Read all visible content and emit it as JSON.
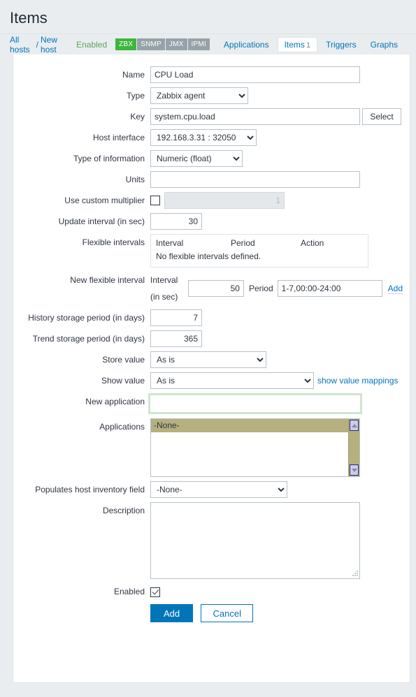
{
  "header": {
    "title": "Items"
  },
  "breadcrumb": {
    "all_hosts": "All hosts",
    "separator": "/",
    "host_name": "New host",
    "status": "Enabled",
    "interfaces": [
      {
        "label": "ZBX",
        "active": true
      },
      {
        "label": "SNMP",
        "active": false
      },
      {
        "label": "JMX",
        "active": false
      },
      {
        "label": "IPMI",
        "active": false
      }
    ],
    "tabs": [
      {
        "label": "Applications",
        "count": "",
        "selected": false
      },
      {
        "label": "Items",
        "count": "1",
        "selected": true
      },
      {
        "label": "Triggers",
        "count": "",
        "selected": false
      },
      {
        "label": "Graphs",
        "count": "",
        "selected": false
      }
    ]
  },
  "form": {
    "name": {
      "label": "Name",
      "value": "CPU Load",
      "placeholder": ""
    },
    "type": {
      "label": "Type",
      "value": "Zabbix agent"
    },
    "key": {
      "label": "Key",
      "value": "system.cpu.load",
      "placeholder": "",
      "select_button": "Select"
    },
    "host_interface": {
      "label": "Host interface",
      "value": "192.168.3.31 : 32050"
    },
    "type_of_information": {
      "label": "Type of information",
      "value": "Numeric (float)"
    },
    "units": {
      "label": "Units",
      "value": "",
      "placeholder": ""
    },
    "custom_multiplier": {
      "label": "Use custom multiplier",
      "checked": false,
      "value": "1"
    },
    "update_interval": {
      "label": "Update interval (in sec)",
      "value": "30"
    },
    "flexible_intervals": {
      "label": "Flexible intervals",
      "columns": [
        "Interval",
        "Period",
        "Action"
      ],
      "empty_text": "No flexible intervals defined."
    },
    "new_flexible_interval": {
      "label": "New flexible interval",
      "interval_label": "Interval (in sec)",
      "interval_value": "50",
      "period_label": "Period",
      "period_value": "1-7,00:00-24:00",
      "add_link": "Add"
    },
    "history_storage": {
      "label": "History storage period (in days)",
      "value": "7"
    },
    "trend_storage": {
      "label": "Trend storage period (in days)",
      "value": "365"
    },
    "store_value": {
      "label": "Store value",
      "value": "As is"
    },
    "show_value": {
      "label": "Show value",
      "value": "As is",
      "link": "show value mappings"
    },
    "new_application": {
      "label": "New application",
      "value": "",
      "placeholder": ""
    },
    "applications": {
      "label": "Applications",
      "options": [
        "-None-"
      ],
      "selected": "-None-"
    },
    "host_inventory_field": {
      "label": "Populates host inventory field",
      "value": "-None-"
    },
    "description": {
      "label": "Description",
      "value": "",
      "placeholder": ""
    },
    "enabled": {
      "label": "Enabled",
      "checked": true
    },
    "buttons": {
      "submit": "Add",
      "cancel": "Cancel"
    }
  },
  "colors": {
    "page_bg": "#e9edf0",
    "panel_bg": "#ffffff",
    "link": "#0275b8",
    "status_green": "#59a659",
    "badge_active": "#3db63d",
    "badge_inactive": "#97a1a8",
    "select_highlight": "#b5b07e",
    "focus_green": "#cfe5cf"
  }
}
